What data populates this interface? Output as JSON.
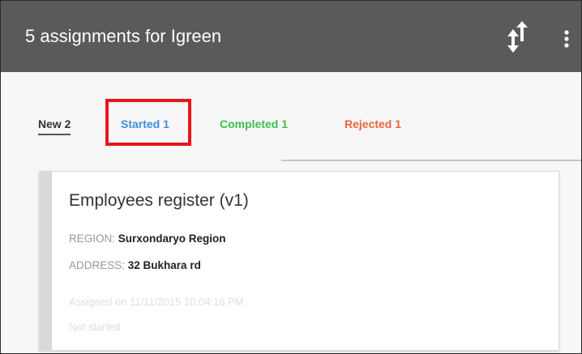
{
  "header": {
    "title": "5 assignments for Igreen",
    "sync_icon": "sort-arrows-icon",
    "menu_icon": "more-vert-icon"
  },
  "tabs": [
    {
      "label": "New 2",
      "color": "#333333"
    },
    {
      "label": "Started 1",
      "color": "#3f8fd8"
    },
    {
      "label": "Completed 1",
      "color": "#3cbf4a"
    },
    {
      "label": "Rejected 1",
      "color": "#e8663c"
    }
  ],
  "highlight_color": "#e8151c",
  "assignment": {
    "title": "Employees register (v1)",
    "fields": [
      {
        "label": "REGION: ",
        "value": "Surxondaryo Region"
      },
      {
        "label": "ADDRESS: ",
        "value": "32 Bukhara rd"
      }
    ],
    "assigned_on": "Assigned on 11/11/2015 10:04:16 PM",
    "status": "Not started"
  }
}
